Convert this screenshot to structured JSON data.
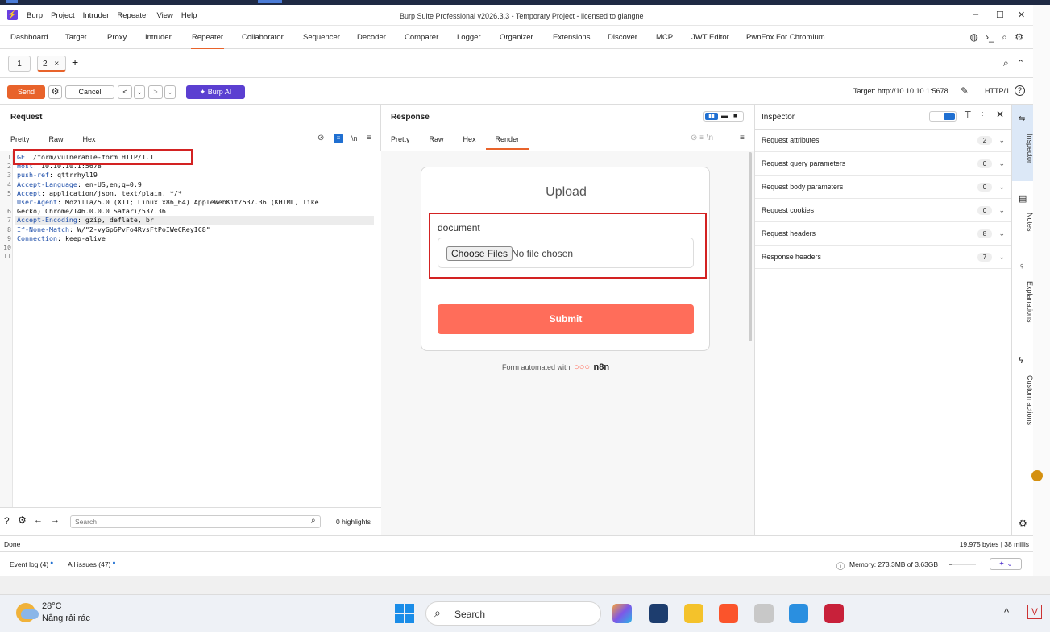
{
  "titlebar": {
    "logo": "⚡",
    "menu": [
      "Burp",
      "Project",
      "Intruder",
      "Repeater",
      "View",
      "Help"
    ],
    "title": "Burp Suite Professional v2026.3.3 - Temporary Project - licensed to giangne",
    "minimize": "–",
    "maximize": "☐",
    "close": "✕"
  },
  "nav": {
    "tabs": [
      "Dashboard",
      "Target",
      "Proxy",
      "Intruder",
      "Repeater",
      "Collaborator",
      "Sequencer",
      "Decoder",
      "Comparer",
      "Logger",
      "Organizer",
      "Extensions",
      "Discover",
      "MCP",
      "JWT Editor",
      "PwnFox For Chromium"
    ],
    "active": "Repeater",
    "icons": [
      "globe-icon",
      "terminal-icon",
      "search-icon",
      "gear-icon"
    ]
  },
  "subtabs": {
    "tab1": "1",
    "tab2": "2",
    "tab2_close": "×",
    "add": "+",
    "search_icon": "⌕",
    "collapse_icon": "⌃"
  },
  "toolbar": {
    "send": "Send",
    "cancel": "Cancel",
    "back": "<",
    "back_drop": "⌄",
    "forward": ">",
    "forward_drop": "⌄",
    "burpai": "✦ Burp AI",
    "target": "Target: http://10.10.10.1:5678",
    "protocol": "HTTP/1",
    "help": "?"
  },
  "request": {
    "title": "Request",
    "tabs": [
      "Pretty",
      "Raw",
      "Hex"
    ],
    "active_tab": "Pretty",
    "line_numbers": [
      "1",
      "2",
      "3",
      "4",
      "5",
      "",
      "6",
      "7",
      "8",
      "9",
      "10",
      "11"
    ],
    "lines": [
      {
        "k": "GET",
        "v": " /form/vulnerable-form HTTP/1.1"
      },
      {
        "k": "Host",
        "v": ": 10.10.10.1:5678"
      },
      {
        "k": "push-ref",
        "v": ": qttrrhyl19"
      },
      {
        "k": "Accept-Language",
        "v": ": en-US,en;q=0.9"
      },
      {
        "k": "Accept",
        "v": ": application/json, text/plain, */*"
      },
      {
        "k": "User-Agent",
        "v": ": Mozilla/5.0 (X11; Linux x86_64) AppleWebKit/537.36 (KHTML, like"
      },
      {
        "k": "",
        "v": "Gecko) Chrome/146.0.0.0 Safari/537.36"
      },
      {
        "k": "Accept-Encoding",
        "v": ": gzip, deflate, br"
      },
      {
        "k": "If-None-Match",
        "v": ": W/\"2-vyGp6PvFo4RvsFtPoIWeCReyIC8\""
      },
      {
        "k": "Connection",
        "v": ": keep-alive"
      },
      {
        "k": "",
        "v": ""
      },
      {
        "k": "",
        "v": ""
      }
    ],
    "search_placeholder": "Search",
    "highlights": "0 highlights"
  },
  "response": {
    "title": "Response",
    "tabs": [
      "Pretty",
      "Raw",
      "Hex",
      "Render"
    ],
    "active_tab": "Render",
    "render": {
      "heading": "Upload",
      "field_label": "document",
      "file_button": "Choose Files",
      "file_status": "No file chosen",
      "submit": "Submit",
      "footer": "Form automated with",
      "brand": "n8n"
    }
  },
  "inspector": {
    "title": "Inspector",
    "rows": [
      {
        "label": "Request attributes",
        "count": "2"
      },
      {
        "label": "Request query parameters",
        "count": "0"
      },
      {
        "label": "Request body parameters",
        "count": "0"
      },
      {
        "label": "Request cookies",
        "count": "0"
      },
      {
        "label": "Request headers",
        "count": "8"
      },
      {
        "label": "Response headers",
        "count": "7"
      }
    ]
  },
  "sidebar": {
    "tabs": [
      "Inspector",
      "Notes",
      "Explanations",
      "Custom actions"
    ]
  },
  "status": {
    "left": "Done",
    "right": "19,975 bytes | 38 millis"
  },
  "bottom": {
    "event_log": "Event log (4)",
    "all_issues": "All issues (47)",
    "memory": "Memory: 273.3MB of 3.63GB"
  },
  "taskbar": {
    "temp": "28°C",
    "weather": "Nắng rải rác",
    "search": "Search",
    "tray_up": "^",
    "tray_v": "V"
  },
  "colors": {
    "accent": "#e8632b",
    "burpai": "#5b3fd1",
    "submit": "#ff6d5a",
    "redbox": "#d32222"
  }
}
